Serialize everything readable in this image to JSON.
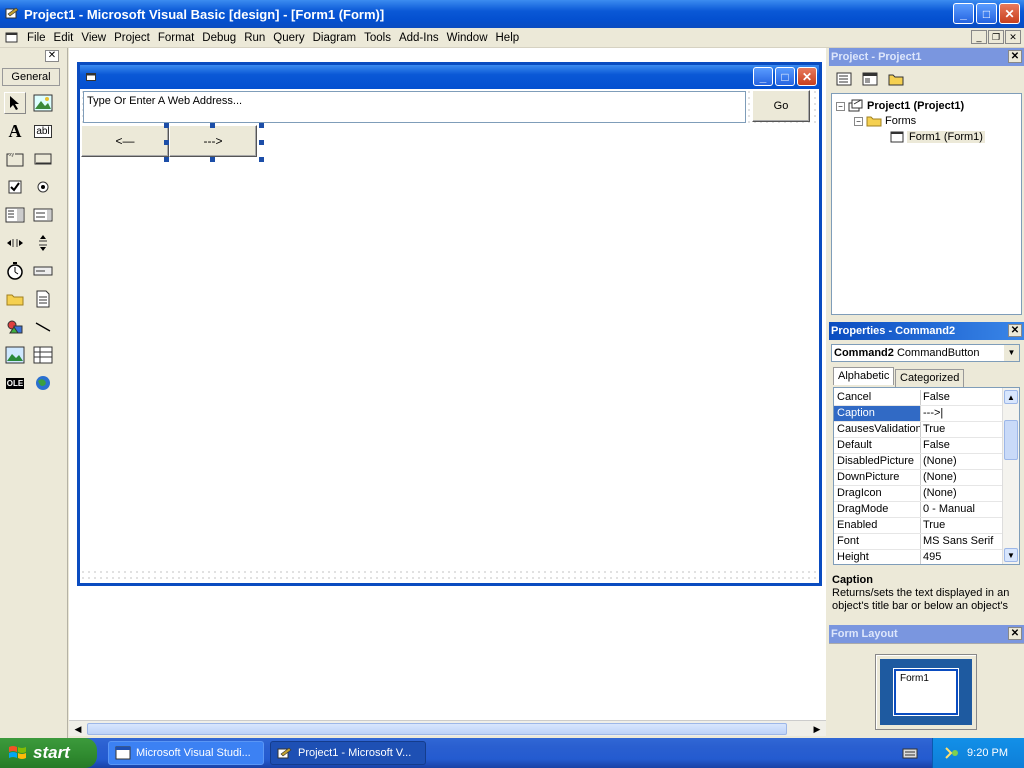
{
  "window": {
    "title": "Project1 - Microsoft Visual Basic [design] - [Form1 (Form)]",
    "minimize": "_",
    "maximize": "□",
    "close": "✕"
  },
  "menu": {
    "items": [
      "File",
      "Edit",
      "View",
      "Project",
      "Format",
      "Debug",
      "Run",
      "Query",
      "Diagram",
      "Tools",
      "Add-Ins",
      "Window",
      "Help"
    ],
    "mdi_minimize": "_",
    "mdi_restore": "❐",
    "mdi_close": "✕"
  },
  "toolbox": {
    "close": "✕",
    "tab": "General",
    "tools": [
      "pointer-icon",
      "picturebox-icon",
      "label-icon",
      "textbox-icon",
      "frame-icon",
      "commandbutton-icon",
      "checkbox-icon",
      "optionbutton-icon",
      "combobox-icon",
      "listbox-icon",
      "hscrollbar-icon",
      "vscrollbar-icon",
      "timer-icon",
      "drivelistbox-icon",
      "dirlistbox-icon",
      "filelistbox-icon",
      "shape-icon",
      "line-icon",
      "image-icon",
      "data-icon",
      "ole-icon",
      "webbrowser-icon"
    ],
    "label_glyph": "A",
    "textbox_glyph": "abl",
    "ole_glyph": "OLE"
  },
  "form": {
    "address_text": "Type Or Enter A Web Address...",
    "go_label": "Go",
    "back_label": "<—",
    "forward_label": "--->"
  },
  "project": {
    "title": "Project - Project1",
    "close": "✕",
    "tree": {
      "project_node": "Project1 (Project1)",
      "forms_node": "Forms",
      "form_node": "Form1 (Form1)",
      "expand_glyph": "−"
    }
  },
  "properties": {
    "title": "Properties - Command2",
    "close": "✕",
    "object_name": "Command2",
    "object_type": "CommandButton",
    "dropdown_glyph": "▼",
    "tabs": [
      "Alphabetic",
      "Categorized"
    ],
    "rows": [
      {
        "name": "Cancel",
        "value": "False"
      },
      {
        "name": "Caption",
        "value": "--->|"
      },
      {
        "name": "CausesValidation",
        "value": "True"
      },
      {
        "name": "Default",
        "value": "False"
      },
      {
        "name": "DisabledPicture",
        "value": "(None)"
      },
      {
        "name": "DownPicture",
        "value": "(None)"
      },
      {
        "name": "DragIcon",
        "value": "(None)"
      },
      {
        "name": "DragMode",
        "value": "0 - Manual"
      },
      {
        "name": "Enabled",
        "value": "True"
      },
      {
        "name": "Font",
        "value": "MS Sans Serif"
      },
      {
        "name": "Height",
        "value": "495"
      }
    ],
    "scroll_up": "▲",
    "scroll_down": "▼",
    "desc_title": "Caption",
    "desc_text": "Returns/sets the text displayed in an object's title bar or below an object's"
  },
  "form_layout": {
    "title": "Form Layout",
    "close": "✕",
    "mini_form_label": "Form1"
  },
  "hscroll": {
    "left": "◀",
    "right": "▶"
  },
  "taskbar": {
    "start": "start",
    "tasks": [
      {
        "label": "Microsoft Visual Studi..."
      },
      {
        "label": "Project1 - Microsoft V..."
      }
    ],
    "clock": "9:20 PM"
  },
  "colors": {
    "title_blue": "#0a58d6",
    "selection_blue": "#316ac5",
    "start_green": "#2f8a2f"
  }
}
